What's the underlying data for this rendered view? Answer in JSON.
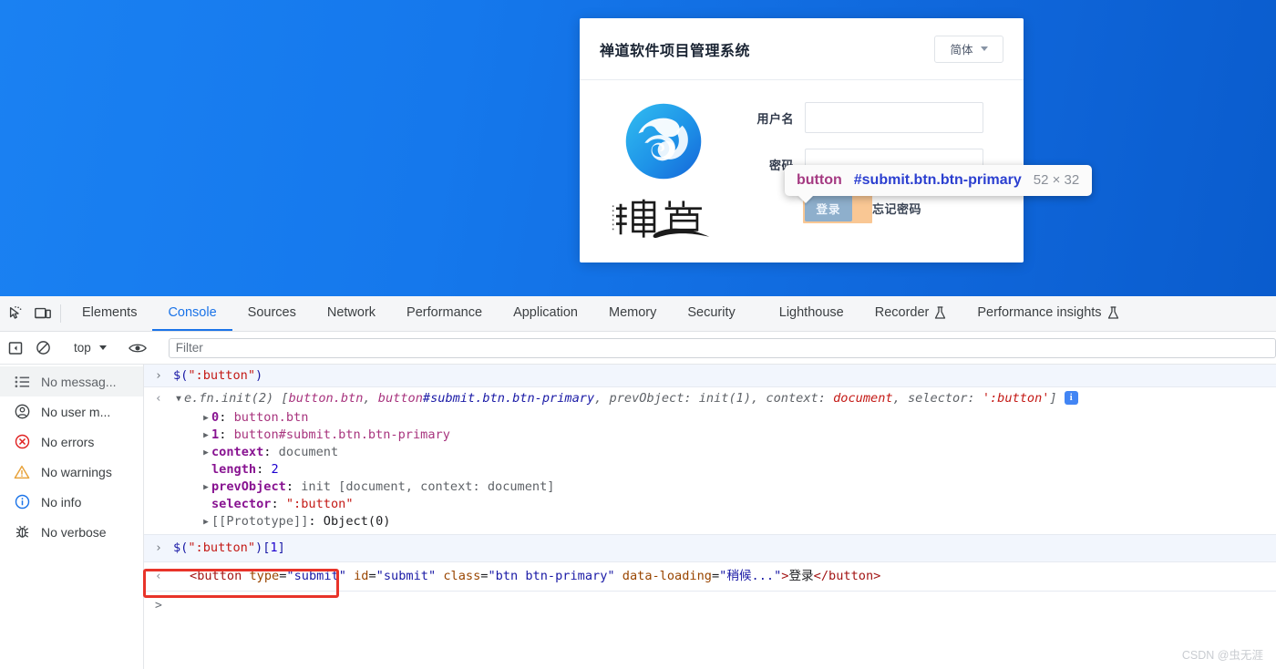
{
  "page": {
    "background_color": "#147bef",
    "login_card": {
      "title": "禅道软件项目管理系统",
      "language_button": "简体",
      "fields": [
        {
          "label": "用户名",
          "value": "",
          "placeholder": ""
        },
        {
          "label": "密码",
          "value": "",
          "placeholder": ""
        }
      ],
      "submit_label": "登录",
      "forgot_label": "忘记密码",
      "logo_alt": "禅道"
    }
  },
  "inspect_tooltip": {
    "tag": "button",
    "selector": "#submit.btn.btn-primary",
    "dimensions": "52 × 32"
  },
  "devtools": {
    "tabs": [
      {
        "label": "Elements",
        "active": false,
        "experimental": false
      },
      {
        "label": "Console",
        "active": true,
        "experimental": false
      },
      {
        "label": "Sources",
        "active": false,
        "experimental": false
      },
      {
        "label": "Network",
        "active": false,
        "experimental": false
      },
      {
        "label": "Performance",
        "active": false,
        "experimental": false
      },
      {
        "label": "Application",
        "active": false,
        "experimental": false
      },
      {
        "label": "Memory",
        "active": false,
        "experimental": false
      },
      {
        "label": "Security",
        "active": false,
        "experimental": false
      },
      {
        "label": "Lighthouse",
        "active": false,
        "experimental": false
      },
      {
        "label": "Recorder",
        "active": false,
        "experimental": true
      },
      {
        "label": "Performance insights",
        "active": false,
        "experimental": true
      }
    ],
    "toolbar": {
      "context": "top",
      "filter_placeholder": "Filter",
      "filter_value": ""
    },
    "sidebar": [
      {
        "label": "No messag...",
        "icon": "list-icon",
        "selected": true
      },
      {
        "label": "No user m...",
        "icon": "user-icon",
        "selected": false
      },
      {
        "label": "No errors",
        "icon": "error-icon",
        "selected": false
      },
      {
        "label": "No warnings",
        "icon": "warning-icon",
        "selected": false
      },
      {
        "label": "No info",
        "icon": "info-icon",
        "selected": false
      },
      {
        "label": "No verbose",
        "icon": "bug-icon",
        "selected": false
      }
    ],
    "console": {
      "entry1_input": {
        "fn": "$(",
        "str": "\":button\"",
        "close": ")"
      },
      "entry1_result": {
        "head": "e.fn.init(2) [",
        "item0": "button.btn",
        "sep1": ", ",
        "item1_tag": "button",
        "item1_sel": "#submit.btn.btn-primary",
        "sep2": ", ",
        "prev_key": "prevObject:",
        "prev_val": "init(1)",
        "sep3": ", ",
        "ctx_key": "context:",
        "ctx_val": "document",
        "sep4": ", ",
        "sel_key": "selector:",
        "sel_val": "':button'",
        "tail": "]",
        "badge": "i"
      },
      "properties": [
        {
          "expandable": true,
          "key": "0",
          "sep": ": ",
          "value": "button.btn",
          "kind": "element"
        },
        {
          "expandable": true,
          "key": "1",
          "sep": ": ",
          "value": "button#submit.btn.btn-primary",
          "kind": "element-id"
        },
        {
          "expandable": true,
          "key": "context",
          "sep": ": ",
          "value": "document",
          "kind": "plain"
        },
        {
          "expandable": false,
          "key": "length",
          "sep": ": ",
          "value": "2",
          "kind": "number"
        },
        {
          "expandable": true,
          "key": "prevObject",
          "sep": ": ",
          "value": "init [document, context: document]",
          "kind": "object"
        },
        {
          "expandable": false,
          "key": "selector",
          "sep": ": ",
          "value": "\":button\"",
          "kind": "string"
        },
        {
          "expandable": true,
          "key": "[[Prototype]]",
          "sep": ": ",
          "value": "Object(0)",
          "kind": "proto"
        }
      ],
      "entry2_input": {
        "fn": "$(",
        "str": "\":button\"",
        "close": ")[",
        "index": "1",
        "close2": "]"
      },
      "entry2_result": {
        "open": "<",
        "tag": "button",
        "attr1": "type",
        "val1": "\"submit\"",
        "attr2": "id",
        "val2": "\"submit\"",
        "attr3": "class",
        "val3": "\"btn btn-primary\"",
        "attr4": "data-loading",
        "val4": "\"稍候...\"",
        "gt": ">",
        "text": "登录",
        "close_tag": "</button>"
      },
      "prompt": ">"
    }
  },
  "watermark": "CSDN @虫无涯"
}
